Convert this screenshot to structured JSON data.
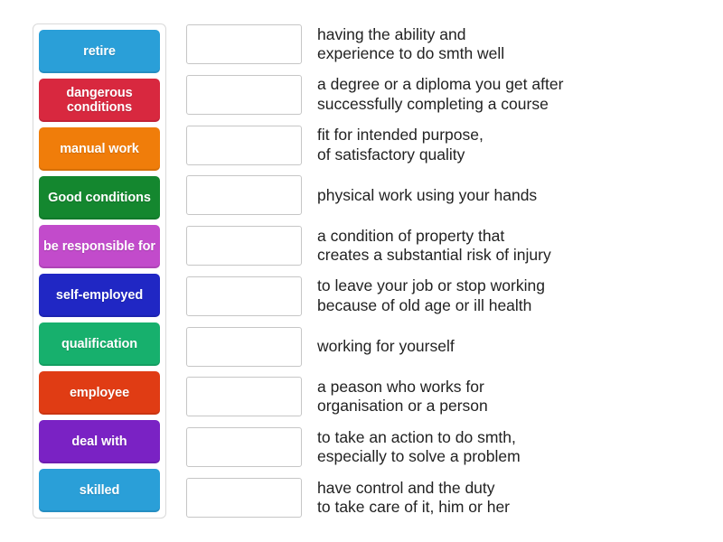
{
  "activity": {
    "type": "match-up",
    "drop_slot_placeholder": ""
  },
  "tiles": [
    {
      "label": "retire",
      "color": "#2a9fd8"
    },
    {
      "label": "dangerous\nconditions",
      "color": "#d8283f"
    },
    {
      "label": "manual work",
      "color": "#f07d0a"
    },
    {
      "label": "Good\nconditions",
      "color": "#14872f"
    },
    {
      "label": "be responsible\nfor",
      "color": "#c24bcb"
    },
    {
      "label": "self-employed",
      "color": "#2027c4"
    },
    {
      "label": "qualification",
      "color": "#17b06d"
    },
    {
      "label": "employee",
      "color": "#e03c14"
    },
    {
      "label": "deal with",
      "color": "#7a22c4"
    },
    {
      "label": "skilled",
      "color": "#2a9fd8"
    }
  ],
  "definitions": [
    "having the ability and\nexperience to do smth well",
    "a degree or a diploma you get after\nsuccessfully completing a course",
    "fit for intended purpose,\nof satisfactory quality",
    "physical work using your hands",
    "a condition of property that\ncreates a substantial risk of injury",
    "to leave your job or stop working\nbecause of old age or ill health",
    "working for yourself",
    "a peason who works for\norganisation or a person",
    "to take an action to do smth,\nespecially to solve a problem",
    "have control and the duty\nto take care of it, him or her"
  ]
}
